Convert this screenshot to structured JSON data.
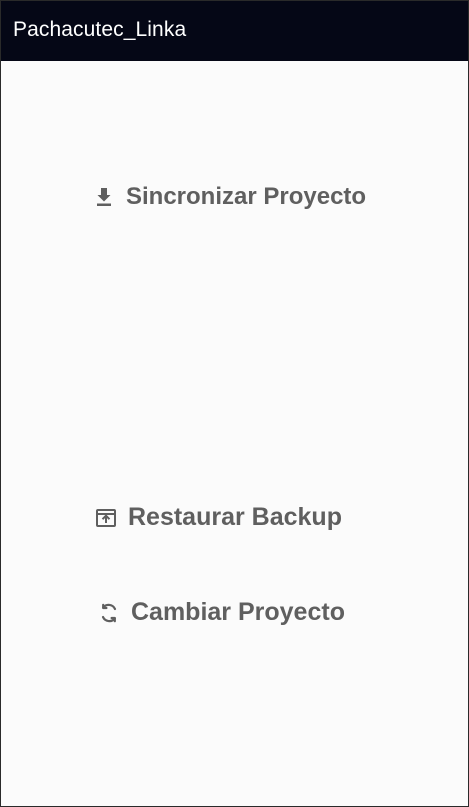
{
  "app_bar": {
    "title": "Pachacutec_Linka"
  },
  "actions": {
    "sync": {
      "label": "Sincronizar Proyecto",
      "icon": "download-icon"
    },
    "restore": {
      "label": "Restaurar Backup",
      "icon": "restore-backup-icon"
    },
    "change": {
      "label": "Cambiar Proyecto",
      "icon": "refresh-icon"
    }
  },
  "colors": {
    "app_bar_background": "#050716",
    "app_bar_text": "#ffffff",
    "page_background": "#fbfbfb",
    "action_text": "#5f5f5f"
  }
}
